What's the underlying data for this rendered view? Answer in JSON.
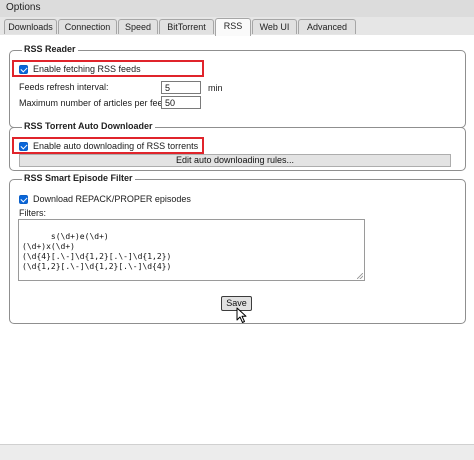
{
  "window": {
    "title": "Options"
  },
  "tabs": [
    {
      "label": "Downloads",
      "active": false
    },
    {
      "label": "Connection",
      "active": false
    },
    {
      "label": "Speed",
      "active": false
    },
    {
      "label": "BitTorrent",
      "active": false
    },
    {
      "label": "RSS",
      "active": true
    },
    {
      "label": "Web UI",
      "active": false
    },
    {
      "label": "Advanced",
      "active": false
    }
  ],
  "rss_reader": {
    "legend": "RSS Reader",
    "enable_label": "Enable fetching RSS feeds",
    "enable_checked": true,
    "refresh_label": "Feeds refresh interval:",
    "refresh_value": "5",
    "refresh_unit": "min",
    "max_articles_label": "Maximum number of articles per feed:",
    "max_articles_value": "50"
  },
  "auto_downloader": {
    "legend": "RSS Torrent Auto Downloader",
    "enable_label": "Enable auto downloading of RSS torrents",
    "enable_checked": true,
    "edit_rules_label": "Edit auto downloading rules..."
  },
  "smart_filter": {
    "legend": "RSS Smart Episode Filter",
    "repack_label": "Download REPACK/PROPER episodes",
    "repack_checked": true,
    "filters_label": "Filters:",
    "filters_value": "s(\\d+)e(\\d+)\n(\\d+)x(\\d+)\n(\\d{4}[.\\-]\\d{1,2}[.\\-]\\d{1,2})\n(\\d{1,2}[.\\-]\\d{1,2}[.\\-]\\d{4})"
  },
  "footer": {
    "save_label": "Save"
  },
  "colors": {
    "highlight": "#e0242b",
    "checkbox": "#0a66d9"
  }
}
